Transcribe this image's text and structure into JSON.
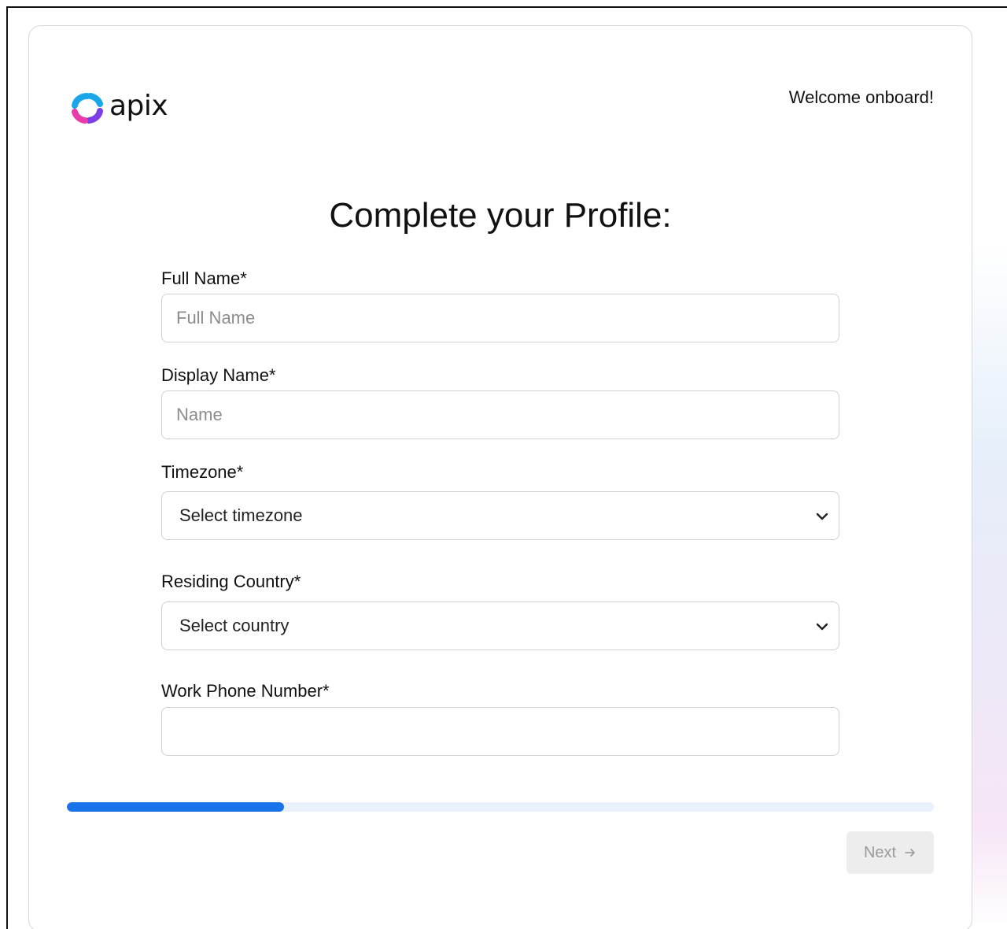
{
  "header": {
    "logo_text": "apix",
    "welcome": "Welcome onboard!"
  },
  "form": {
    "title": "Complete your Profile:",
    "full_name": {
      "label": "Full Name*",
      "placeholder": "Full Name",
      "value": ""
    },
    "display_name": {
      "label": "Display Name*",
      "placeholder": "Name",
      "value": ""
    },
    "timezone": {
      "label": "Timezone*",
      "selected": "Select timezone"
    },
    "country": {
      "label": "Residing Country*",
      "selected": "Select country"
    },
    "work_phone": {
      "label": "Work Phone Number*",
      "value": ""
    }
  },
  "progress": {
    "percent": 25,
    "color": "#1a73e8",
    "track_color": "#e8f1fc"
  },
  "footer": {
    "next_label": "Next",
    "next_icon": "arrow-right-icon",
    "next_enabled": false
  },
  "colors": {
    "logo_blue": "#1aa6e8",
    "logo_pink": "#ea3ca8",
    "logo_purple": "#7b3fe4"
  }
}
